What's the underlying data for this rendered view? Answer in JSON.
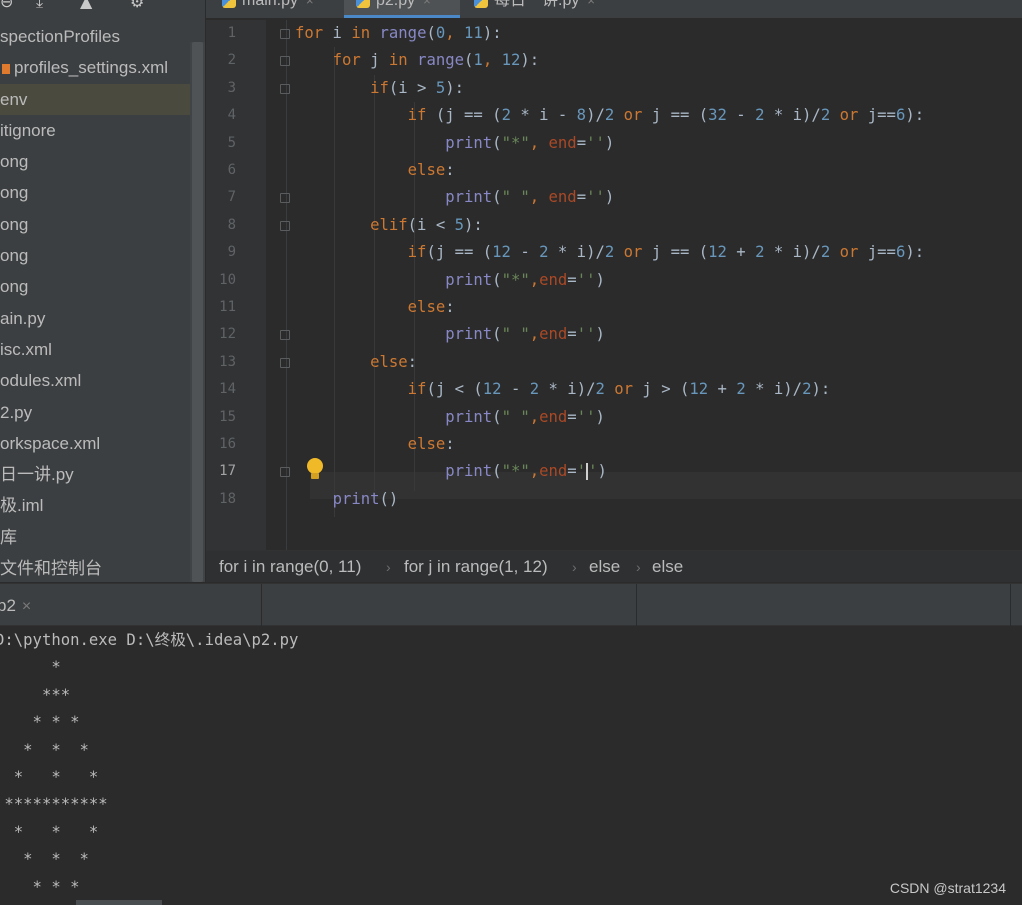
{
  "sidebar": {
    "items": [
      {
        "label": "spectionProfiles"
      },
      {
        "label": "profiles_settings.xml"
      },
      {
        "label": "env"
      },
      {
        "label": "itignore"
      },
      {
        "label": "ong"
      },
      {
        "label": "ong"
      },
      {
        "label": "ong"
      },
      {
        "label": "ong"
      },
      {
        "label": "ong"
      },
      {
        "label": "ain.py"
      },
      {
        "label": "isc.xml"
      },
      {
        "label": "odules.xml"
      },
      {
        "label": "2.py"
      },
      {
        "label": "orkspace.xml"
      },
      {
        "label": "日一讲.py"
      },
      {
        "label": "极.iml"
      },
      {
        "label": "库"
      },
      {
        "label": "文件和控制台"
      }
    ]
  },
  "editor": {
    "tabs": [
      {
        "label": "main.py",
        "close": "×"
      },
      {
        "label": "p2.py",
        "close": "×"
      },
      {
        "label": "每日一讲.py",
        "close": "×"
      }
    ],
    "line_numbers": [
      "1",
      "2",
      "3",
      "4",
      "5",
      "6",
      "7",
      "8",
      "9",
      "10",
      "11",
      "12",
      "13",
      "14",
      "15",
      "16",
      "17",
      "18"
    ],
    "current_line": "17",
    "code": [
      "for i in range(0, 11):",
      "    for j in range(1, 12):",
      "        if(i > 5):",
      "            if (j == (2 * i - 8)/2 or j == (32 - 2 * i)/2 or j==6):",
      "                print(\"*\", end='')",
      "            else:",
      "                print(\" \", end='')",
      "        elif(i < 5):",
      "            if(j == (12 - 2 * i)/2 or j == (12 + 2 * i)/2 or j==6):",
      "                print(\"*\",end='')",
      "            else:",
      "                print(\" \",end='')",
      "        else:",
      "            if(j < (12 - 2 * i)/2 or j > (12 + 2 * i)/2):",
      "                print(\" \",end='')",
      "            else:",
      "                print(\"*\",end='')",
      "    print()"
    ],
    "breadcrumbs": [
      "for i in range(0, 11)",
      "for j in range(1, 12)",
      "else",
      "else"
    ]
  },
  "run": {
    "tab_label": "p2",
    "tab_close": "×",
    "output": [
      "D:\\python.exe D:\\终极\\.idea\\p2.py",
      "      *",
      "     ***",
      "    * * *",
      "   *  *  *",
      "  *   *   *",
      " ***********",
      "  *   *   *",
      "   *  *  *",
      "    * * *"
    ]
  },
  "watermark": "CSDN @strat1234",
  "icons": [
    "collapse-icon",
    "expand-icon",
    "scroll-up-icon",
    "settings-gear-icon",
    "python-file-icon",
    "xml-file-icon",
    "fold-marker-icon",
    "intention-bulb-icon",
    "breadcrumb-separator-icon",
    "close-icon"
  ],
  "colors": {
    "keyword": "#cc7832",
    "number": "#6897bb",
    "builtin": "#8888c6",
    "string": "#6a8759",
    "param": "#aa4926",
    "identifier": "#a9b7c6",
    "background": "#2b2b2b"
  }
}
